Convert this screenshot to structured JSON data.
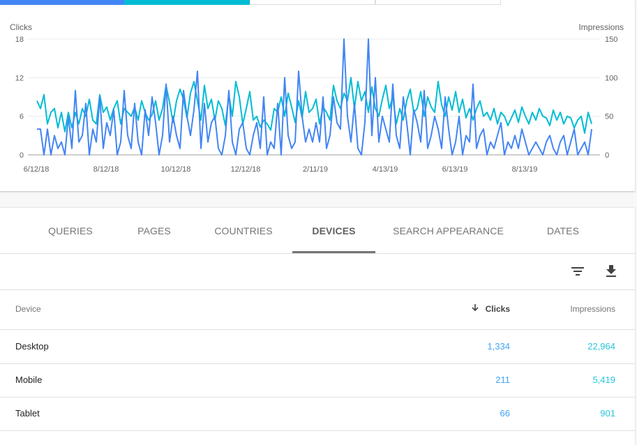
{
  "metric_tabs": [
    {
      "name": "total-clicks",
      "color": "#4285f4"
    },
    {
      "name": "total-impressions",
      "color": "#00bcd4"
    },
    {
      "name": "average-ctr",
      "color": "#ffffff"
    },
    {
      "name": "average-position",
      "color": "#ffffff"
    }
  ],
  "chart_data": {
    "type": "line",
    "title": "",
    "left_axis_label": "Clicks",
    "right_axis_label": "Impressions",
    "left_ylim": [
      0,
      18
    ],
    "right_ylim": [
      0,
      150
    ],
    "left_ticks": [
      "0",
      "6",
      "12",
      "18"
    ],
    "right_ticks": [
      "0",
      "50",
      "100",
      "150"
    ],
    "x_tick_labels": [
      "6/12/18",
      "8/12/18",
      "10/12/18",
      "12/12/18",
      "2/11/19",
      "4/13/19",
      "6/13/19",
      "8/13/19"
    ],
    "x_range": [
      "6/5/18",
      "10/3/19"
    ],
    "grid": true,
    "legend": "none",
    "series": [
      {
        "name": "Clicks",
        "axis": "left",
        "color": "#4285f4",
        "values": [
          4,
          4,
          0,
          4,
          0,
          3,
          1,
          2,
          0,
          6,
          1,
          10,
          2,
          3,
          8,
          0,
          4,
          2,
          9,
          1,
          5,
          3,
          7,
          0,
          2,
          10,
          3,
          1,
          8,
          2,
          0,
          7,
          3,
          9,
          5,
          0,
          3,
          11,
          2,
          6,
          3,
          1,
          10,
          6,
          3,
          7,
          13,
          1,
          8,
          2,
          5,
          6,
          1,
          0,
          3,
          10,
          2,
          0,
          4,
          5,
          1,
          0,
          3,
          5,
          1,
          9,
          0,
          2,
          1,
          8,
          0,
          12,
          3,
          1,
          2,
          13,
          6,
          2,
          4,
          2,
          5,
          2,
          9,
          1,
          3,
          9,
          5,
          4,
          18,
          6,
          2,
          8,
          1,
          0,
          5,
          18,
          3,
          12,
          2,
          6,
          4,
          2,
          11,
          3,
          1,
          9,
          5,
          0,
          7,
          5,
          2,
          10,
          1,
          3,
          6,
          4,
          1,
          9,
          4,
          0,
          2,
          6,
          0,
          3,
          2,
          11,
          1,
          3,
          4,
          0,
          2,
          1,
          3,
          5,
          0,
          2,
          1,
          3,
          1,
          4,
          2,
          0,
          1,
          2,
          1,
          0,
          2,
          3,
          1,
          0,
          2,
          3,
          0,
          2,
          4,
          0,
          1,
          2,
          0,
          4
        ]
      },
      {
        "name": "Impressions",
        "axis": "left-scaled-right",
        "color": "#00bcd4",
        "values": [
          70,
          60,
          78,
          40,
          55,
          60,
          35,
          55,
          30,
          55,
          35,
          55,
          40,
          60,
          50,
          72,
          45,
          40,
          78,
          55,
          62,
          45,
          60,
          70,
          40,
          60,
          55,
          50,
          62,
          45,
          70,
          55,
          45,
          52,
          70,
          45,
          60,
          90,
          68,
          42,
          70,
          85,
          72,
          48,
          80,
          95,
          70,
          45,
          90,
          60,
          72,
          45,
          70,
          60,
          38,
          78,
          50,
          95,
          75,
          40,
          60,
          82,
          45,
          50,
          36,
          45,
          40,
          32,
          60,
          55,
          75,
          50,
          80,
          62,
          42,
          70,
          48,
          82,
          55,
          60,
          72,
          40,
          62,
          55,
          45,
          90,
          70,
          60,
          80,
          70,
          100,
          60,
          95,
          70,
          82,
          55,
          88,
          60,
          50,
          72,
          90,
          60,
          75,
          40,
          60,
          45,
          70,
          85,
          55,
          60,
          82,
          50,
          75,
          62,
          55,
          95,
          65,
          50,
          75,
          58,
          82,
          55,
          72,
          48,
          60,
          45,
          60,
          70,
          50,
          55,
          45,
          60,
          40,
          55,
          50,
          38,
          48,
          58,
          42,
          62,
          50,
          40,
          55,
          45,
          60,
          50,
          48,
          38,
          58,
          45,
          55,
          40,
          50,
          48,
          35,
          45,
          50,
          28,
          55,
          40
        ]
      }
    ]
  },
  "report_tabs": [
    {
      "label": "QUERIES",
      "active": false
    },
    {
      "label": "PAGES",
      "active": false
    },
    {
      "label": "COUNTRIES",
      "active": false
    },
    {
      "label": "DEVICES",
      "active": true
    },
    {
      "label": "SEARCH APPEARANCE",
      "active": false
    },
    {
      "label": "DATES",
      "active": false
    }
  ],
  "toolbar": {
    "filter_icon": "filter-list-icon",
    "download_icon": "download-icon"
  },
  "table": {
    "columns": {
      "device": "Device",
      "clicks": "Clicks",
      "impressions": "Impressions",
      "sort_icon": "arrow-downward-icon"
    },
    "colors": {
      "clicks": "#42a5f5",
      "impressions": "#26c6da"
    },
    "rows": [
      {
        "device": "Desktop",
        "clicks": "1,334",
        "impressions": "22,964"
      },
      {
        "device": "Mobile",
        "clicks": "211",
        "impressions": "5,419"
      },
      {
        "device": "Tablet",
        "clicks": "66",
        "impressions": "901"
      }
    ]
  }
}
